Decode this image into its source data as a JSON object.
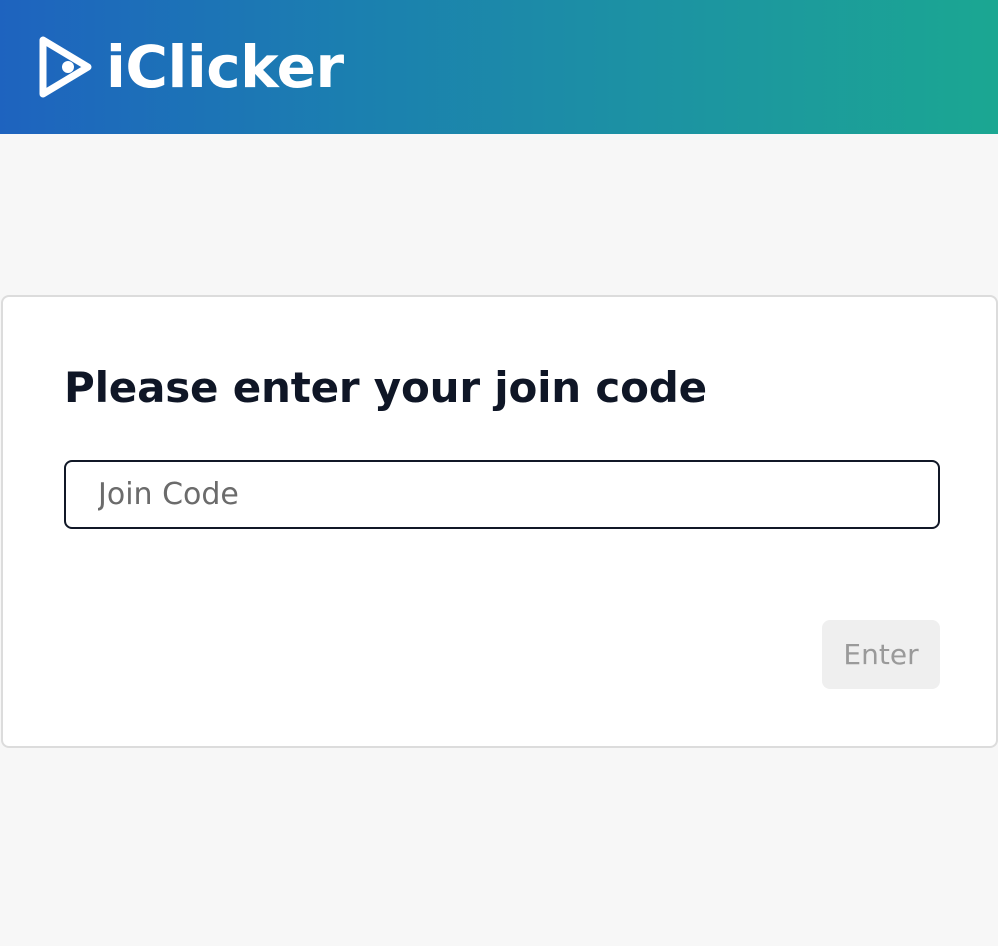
{
  "header": {
    "brand": "iClicker",
    "logo_icon": "play-chevron-icon",
    "gradient_start": "#1e63bf",
    "gradient_end": "#1ba792"
  },
  "card": {
    "title": "Please enter your join code",
    "join_code": {
      "value": "",
      "placeholder": "Join Code"
    },
    "enter_button": {
      "label": "Enter",
      "disabled": true
    }
  }
}
